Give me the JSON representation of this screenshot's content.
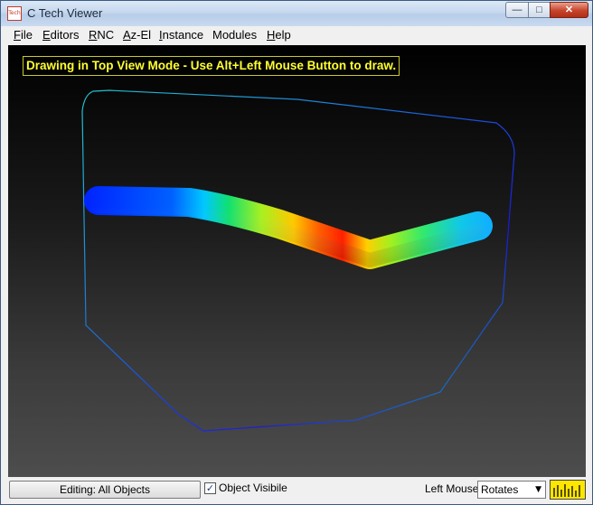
{
  "window": {
    "title": "C Tech Viewer",
    "icon": "ctech-app-icon",
    "icon_text": "Tech",
    "controls": {
      "minimize": "minimize-icon",
      "maximize": "maximize-icon",
      "close": "close-icon"
    }
  },
  "menu": {
    "items": [
      {
        "label_u": "F",
        "label_rest": "ile"
      },
      {
        "label_u": "E",
        "label_rest": "ditors"
      },
      {
        "label_u": "R",
        "label_rest": "NC"
      },
      {
        "label_u": "A",
        "label_rest": "z-El"
      },
      {
        "label_u": "I",
        "label_rest": "nstance"
      },
      {
        "label_u": "",
        "label_rest": "Modules"
      },
      {
        "label_u": "H",
        "label_rest": "elp"
      }
    ]
  },
  "viewport": {
    "banner": "Drawing in Top View Mode - Use Alt+Left Mouse Button to draw.",
    "colors": {
      "banner_text": "#ffff33",
      "background_top": "#000000",
      "background_bottom": "#4d4d4d"
    }
  },
  "status": {
    "editing_label": "Editing: All Objects",
    "object_visible": {
      "checked": true,
      "label": "Object Visibile"
    },
    "left_mouse_label": "Left Mouse",
    "left_mouse_mode": "Rotates",
    "meter_icon": "activity-meter-icon",
    "colors": {
      "meter": "#ffe600"
    }
  }
}
